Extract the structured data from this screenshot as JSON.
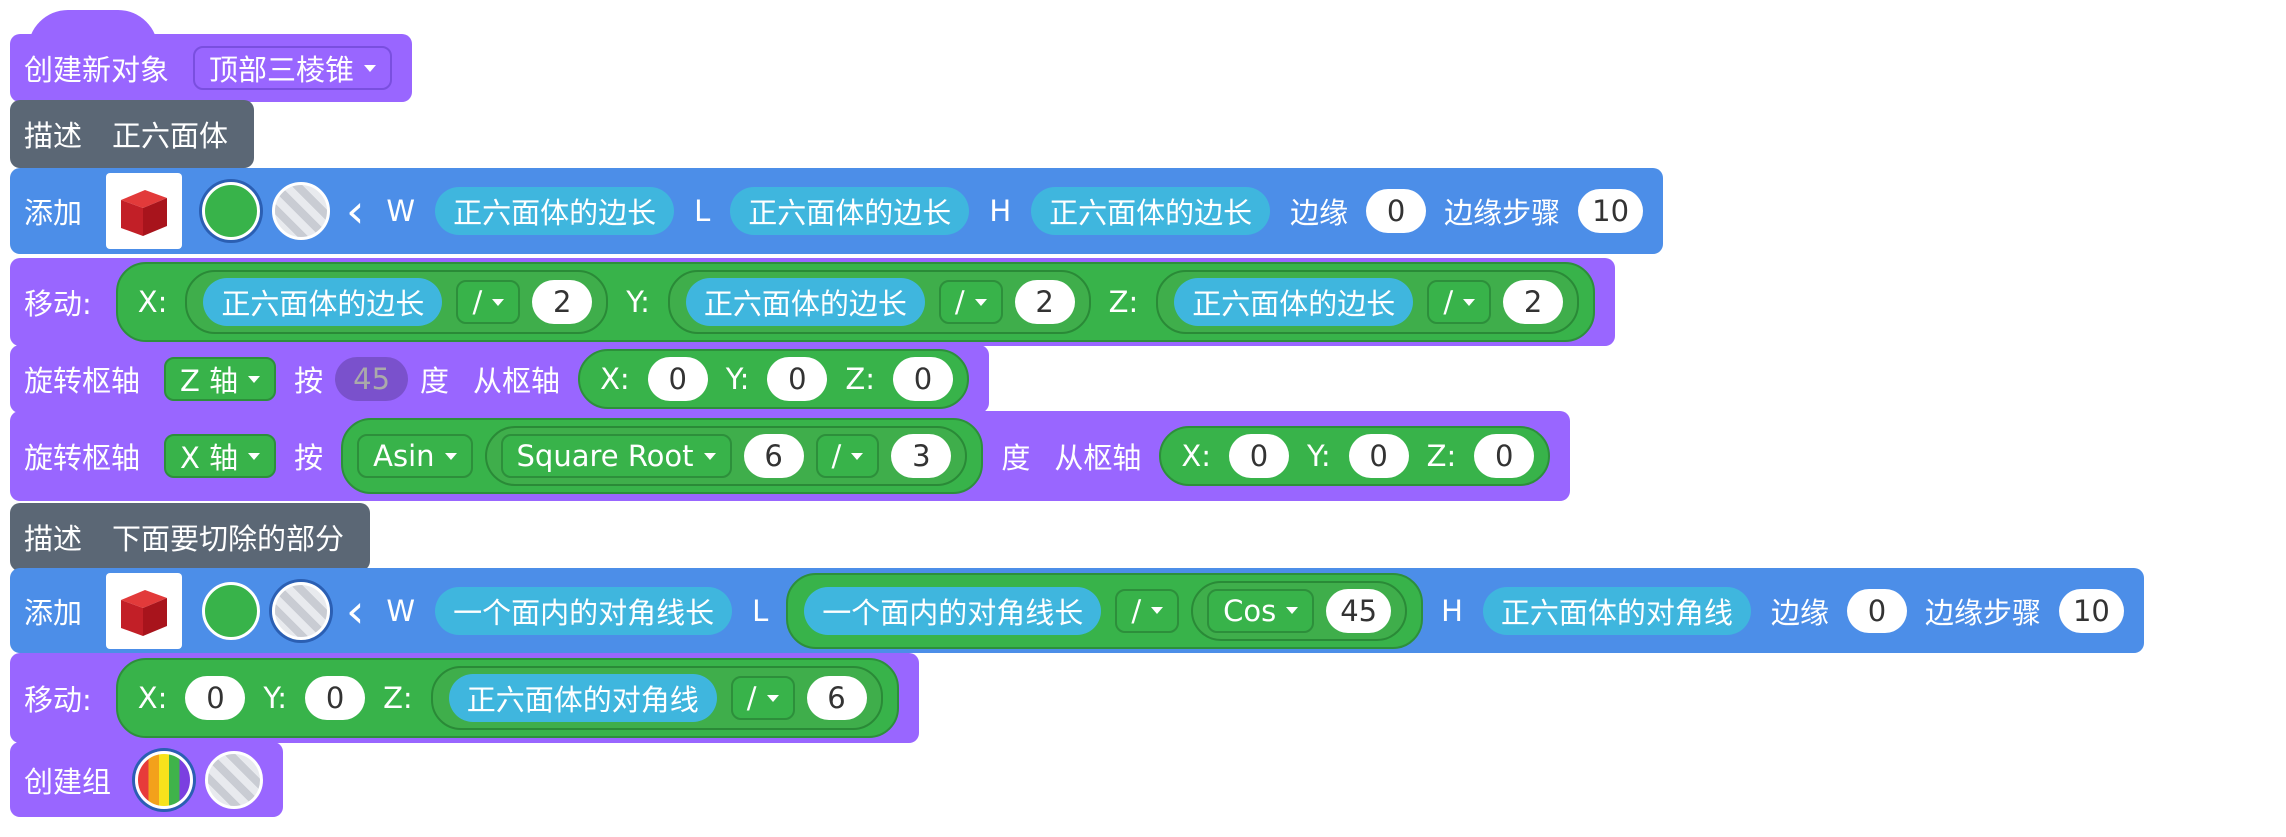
{
  "r1": {
    "label": "创建新对象",
    "dropdown": "顶部三棱锥"
  },
  "r2": {
    "label": "描述",
    "text": "正六面体"
  },
  "r3": {
    "label": "添加",
    "W": "W",
    "L": "L",
    "H": "H",
    "edge": "边缘",
    "edge_val": "0",
    "steps": "边缘步骤",
    "steps_val": "10",
    "w_val": "正六面体的边长",
    "l_val": "正六面体的边长",
    "h_val": "正六面体的边长"
  },
  "r4": {
    "label": "移动:",
    "X": "X:",
    "Y": "Y:",
    "Z": "Z:",
    "x_val": "正六面体的边长",
    "y_val": "正六面体的边长",
    "z_val": "正六面体的边长",
    "op": "/",
    "div": "2"
  },
  "r5": {
    "label": "旋转枢轴",
    "axis": "Z 轴",
    "by": "按",
    "deg_val": "45",
    "deg": "度",
    "pivot": "从枢轴",
    "X": "X:",
    "Y": "Y:",
    "Z": "Z:",
    "x": "0",
    "y": "0",
    "z": "0"
  },
  "r6": {
    "label": "旋转枢轴",
    "axis": "X 轴",
    "by": "按",
    "fn": "Asin",
    "sqrt": "Square Root",
    "a": "6",
    "op": "/",
    "b": "3",
    "deg": "度",
    "pivot": "从枢轴",
    "X": "X:",
    "Y": "Y:",
    "Z": "Z:",
    "x": "0",
    "y": "0",
    "z": "0"
  },
  "r7": {
    "label": "描述",
    "text": "下面要切除的部分"
  },
  "r8": {
    "label": "添加",
    "W": "W",
    "L": "L",
    "H": "H",
    "w_val": "一个面内的对角线长",
    "l_val": "一个面内的对角线长",
    "op": "/",
    "cos": "Cos",
    "cos_val": "45",
    "h_val": "正六面体的对角线",
    "edge": "边缘",
    "edge_val": "0",
    "steps": "边缘步骤",
    "steps_val": "10"
  },
  "r9": {
    "label": "移动:",
    "X": "X:",
    "Y": "Y:",
    "Z": "Z:",
    "x": "0",
    "y": "0",
    "z_val": "正六面体的对角线",
    "op": "/",
    "div": "6"
  },
  "r10": {
    "label": "创建组"
  },
  "colors": {
    "purple": "#9966ff",
    "blue": "#4c8ee8",
    "dark": "#5b6775",
    "green": "#38b34a",
    "cyan": "#3fb6de"
  }
}
